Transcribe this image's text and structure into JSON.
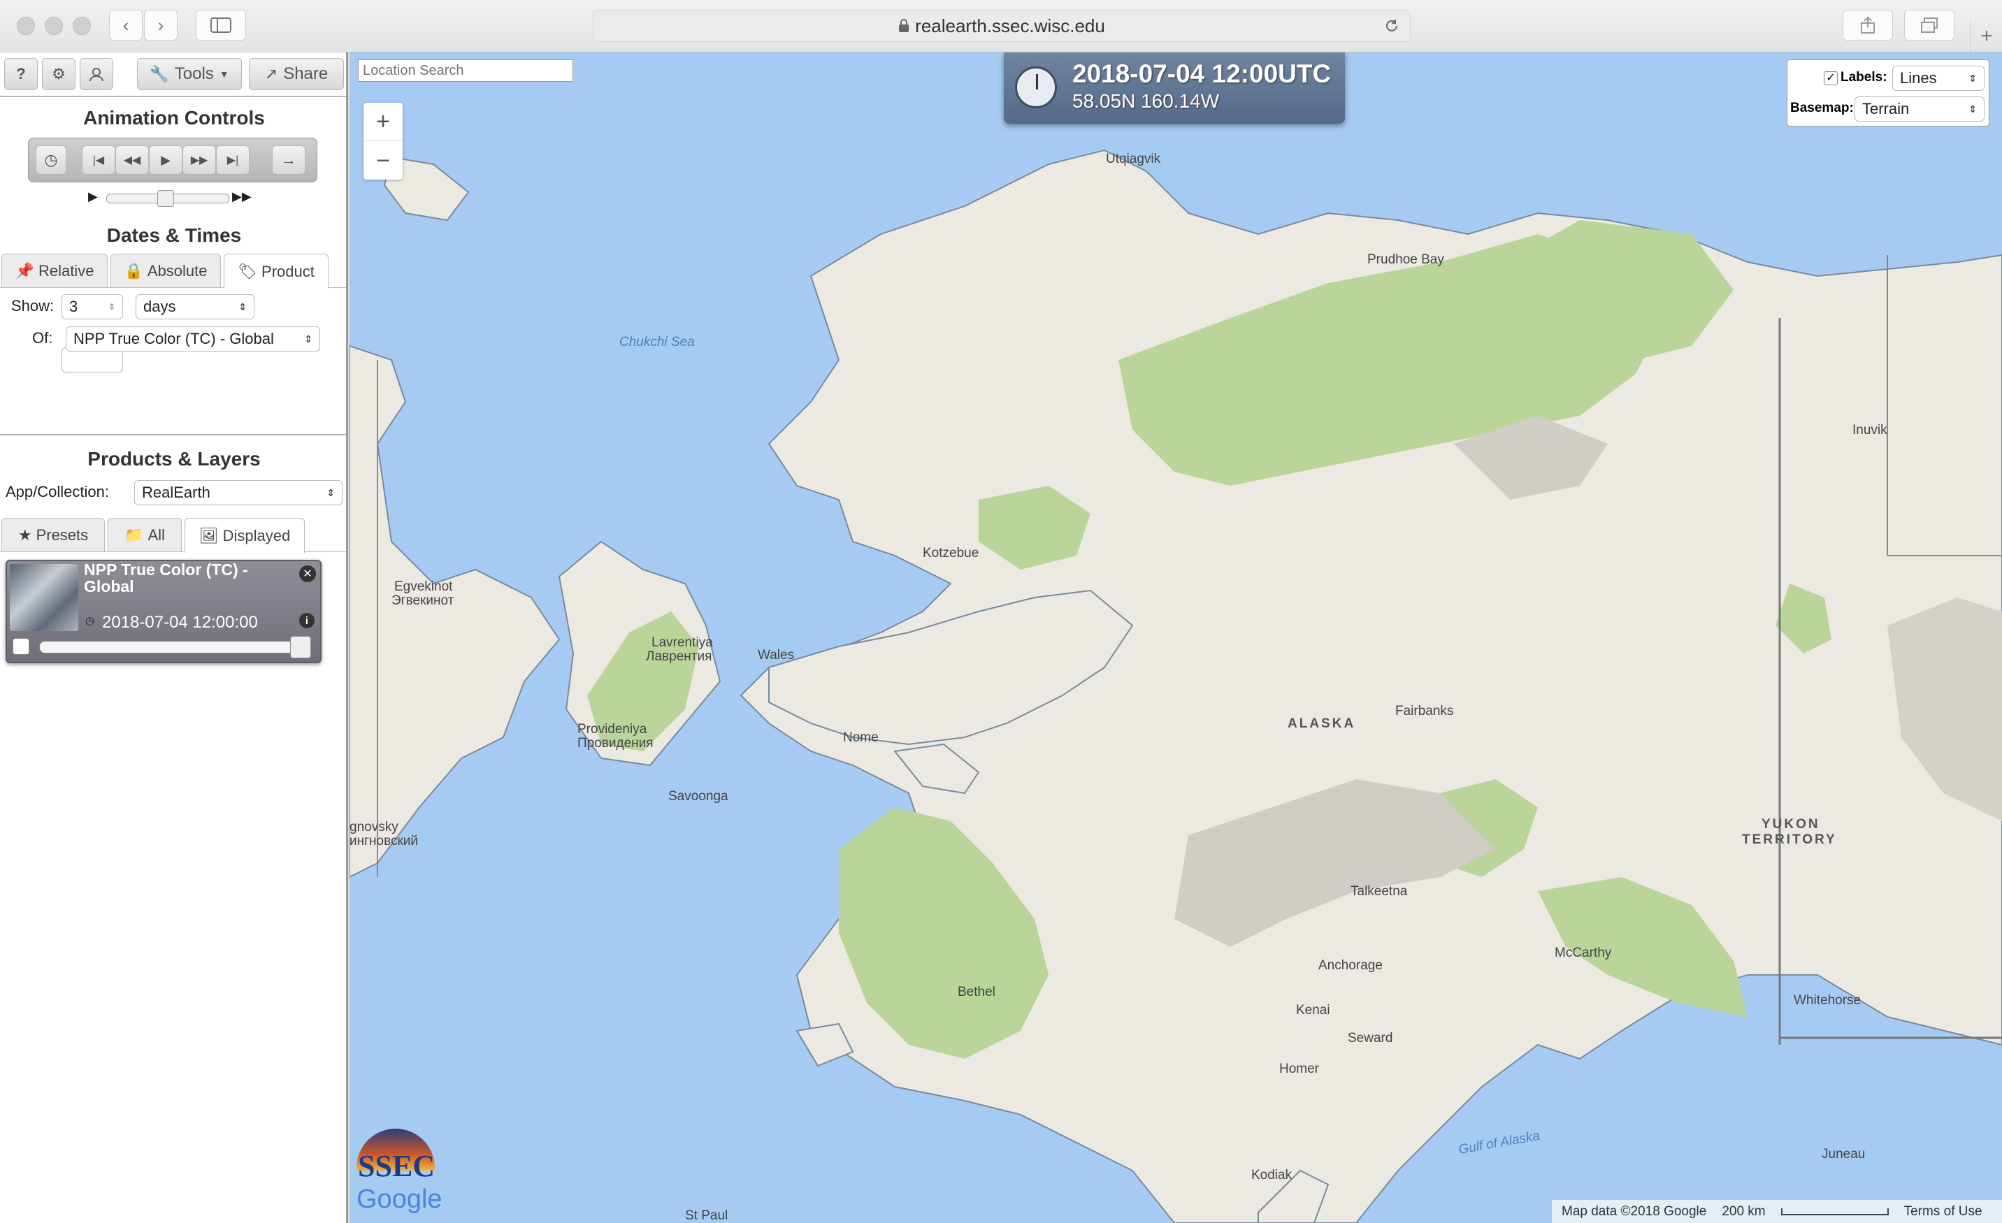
{
  "browser": {
    "url": "realearth.ssec.wisc.edu",
    "icons": [
      "chevron-left-icon",
      "chevron-right-icon",
      "sidebar-icon",
      "lock-icon",
      "reload-icon",
      "share-icon",
      "tabs-icon",
      "plus-icon"
    ]
  },
  "toolbar": {
    "help": "?",
    "tools_label": "Tools",
    "share_label": "Share"
  },
  "animation": {
    "title": "Animation Controls"
  },
  "dates": {
    "title": "Dates & Times",
    "tabs": [
      {
        "label": "Relative"
      },
      {
        "label": "Absolute"
      },
      {
        "label": "Product"
      }
    ],
    "active_tab": "Product",
    "show_label": "Show:",
    "show_value": "3",
    "show_unit": "days",
    "of_label": "Of:",
    "of_value": "NPP True Color (TC) - Global"
  },
  "products": {
    "title": "Products & Layers",
    "collection_label": "App/Collection:",
    "collection_value": "RealEarth",
    "tabs": [
      {
        "label": "Presets"
      },
      {
        "label": "All"
      },
      {
        "label": "Displayed"
      }
    ],
    "active_tab": "Displayed",
    "layers": [
      {
        "name": "NPP True Color (TC) - Global",
        "time": "2018-07-04 12:00:00",
        "opacity_percent": 100
      }
    ]
  },
  "map": {
    "search_placeholder": "Location Search",
    "time_display": "2018-07-04 12:00UTC",
    "coords": "58.05N 160.14W",
    "labels_label": "Labels:",
    "labels_value": "Lines",
    "labels_checked": true,
    "basemap_label": "Basemap:",
    "basemap_value": "Terrain",
    "zoom_in": "+",
    "zoom_out": "−",
    "attribution": "Map data ©2018 Google",
    "scale": "200 km",
    "terms": "Terms of Use",
    "logo_text": "SSEC",
    "google_text": "Google",
    "place_labels": [
      "Utqiagvik",
      "Prudhoe Bay",
      "Chukchi Sea",
      "Inuvik",
      "Kotzebue",
      "Egvekinot",
      "Эгвекинот",
      "Lavrentiya",
      "Лаврентия",
      "Wales",
      "Provideniya",
      "Провидения",
      "Nome",
      "Savoonga",
      "ALASKA",
      "Fairbanks",
      "gnovsky",
      "ингновский",
      "YUKON",
      "TERRITORY",
      "Talkeetna",
      "McCarthy",
      "Anchorage",
      "Bethel",
      "Kenai",
      "Seward",
      "Whitehorse",
      "Homer",
      "Gulf of Alaska",
      "Kodiak",
      "Juneau",
      "St Paul"
    ]
  }
}
